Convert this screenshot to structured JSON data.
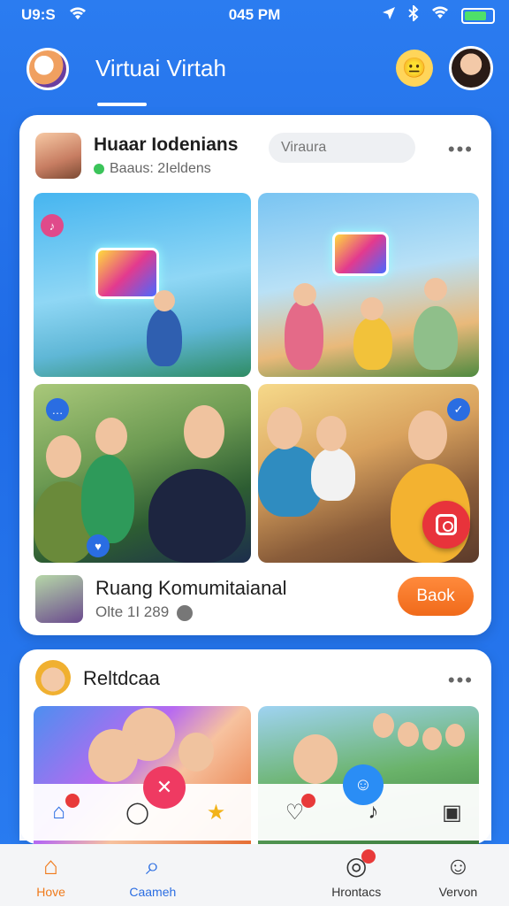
{
  "status_bar": {
    "time_left": "U9:S",
    "time_center": "045 PM"
  },
  "header": {
    "title": "Virtuai Virtah",
    "emoji": "😐"
  },
  "post1": {
    "name": "Huaar Iodenians",
    "subtitle": "Baaus: 2Ieldens",
    "tag_placeholder": "Viraura",
    "more": "•••",
    "community_name": "Ruang Komumitaianal",
    "community_meta": "Olte 1I 289",
    "book_label": "Baok"
  },
  "post2": {
    "name": "Reltdcaa",
    "more": "•••"
  },
  "bottom_nav": {
    "tabs": [
      {
        "label": "Hove",
        "icon": "home-icon"
      },
      {
        "label": "Caameh",
        "icon": "search-icon"
      },
      {
        "label": "",
        "icon": "blank"
      },
      {
        "label": "Hrontacs",
        "icon": "contacts-icon"
      },
      {
        "label": "Vervon",
        "icon": "profile-icon"
      }
    ]
  },
  "colors": {
    "accent": "#2a6de2",
    "orange": "#f07a1a",
    "red": "#e8333b"
  }
}
